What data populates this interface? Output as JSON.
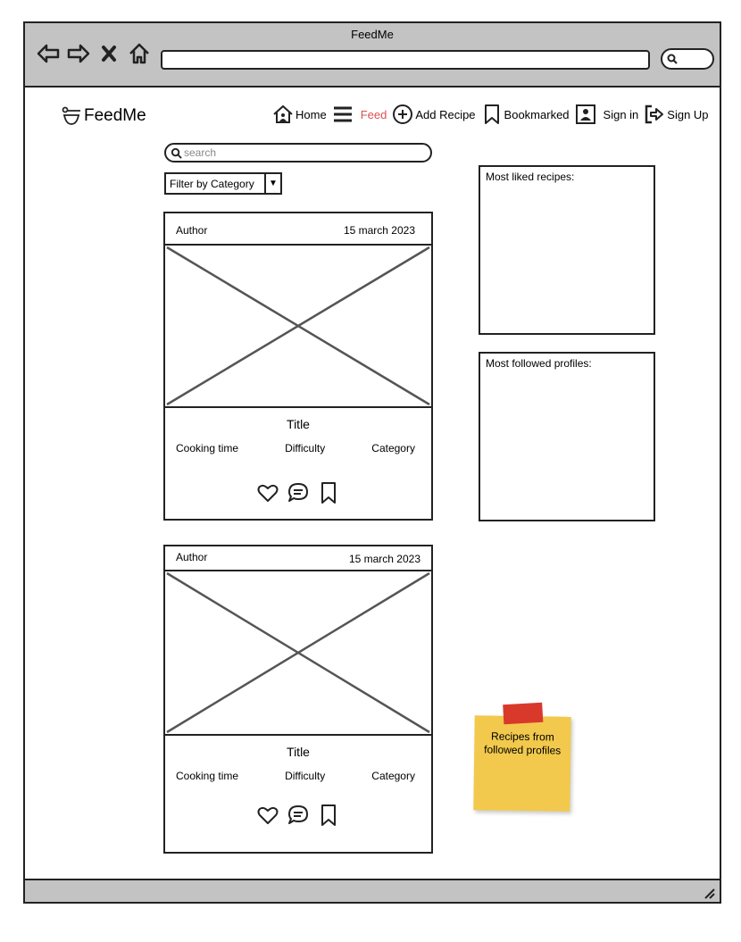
{
  "window": {
    "title": "FeedMe"
  },
  "logo": {
    "text": "FeedMe"
  },
  "nav": {
    "home": "Home",
    "feed": "Feed",
    "add_recipe": "Add Recipe",
    "bookmarked": "Bookmarked",
    "sign_in": "Sign in",
    "sign_up": "Sign Up",
    "active_color": "#e05050"
  },
  "search": {
    "placeholder": "search"
  },
  "filter": {
    "label": "Filter by Category"
  },
  "cards": [
    {
      "author": "Author",
      "date": "15 march 2023",
      "title": "Title",
      "cooking_time": "Cooking time",
      "difficulty": "Difficulty",
      "category": "Category"
    },
    {
      "author": "Author",
      "date": "15 march 2023",
      "title": "Title",
      "cooking_time": "Cooking time",
      "difficulty": "Difficulty",
      "category": "Category"
    }
  ],
  "sidebar": {
    "most_liked": "Most liked recipes:",
    "most_followed": "Most followed profiles:"
  },
  "note": {
    "text": "Recipes from followed profiles",
    "color": "#f2c94c",
    "tape_color": "#d8392b"
  }
}
